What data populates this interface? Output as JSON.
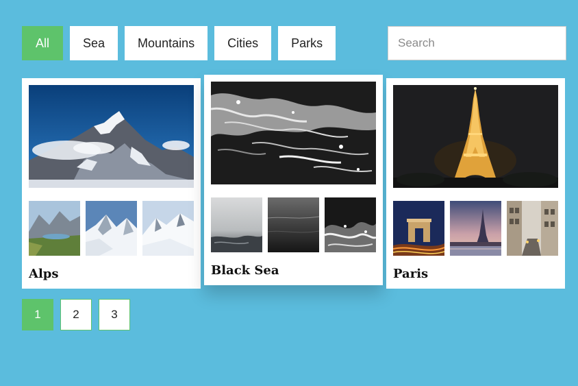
{
  "filters": {
    "all": "All",
    "sea": "Sea",
    "mountains": "Mountains",
    "cities": "Cities",
    "parks": "Parks"
  },
  "search": {
    "placeholder": "Search",
    "value": ""
  },
  "cards": [
    {
      "title": "Alps"
    },
    {
      "title": "Black Sea"
    },
    {
      "title": "Paris"
    }
  ],
  "pagination": [
    "1",
    "2",
    "3"
  ],
  "colors": {
    "background": "#5bbcdd",
    "accent": "#5ec36b",
    "card": "#ffffff"
  }
}
